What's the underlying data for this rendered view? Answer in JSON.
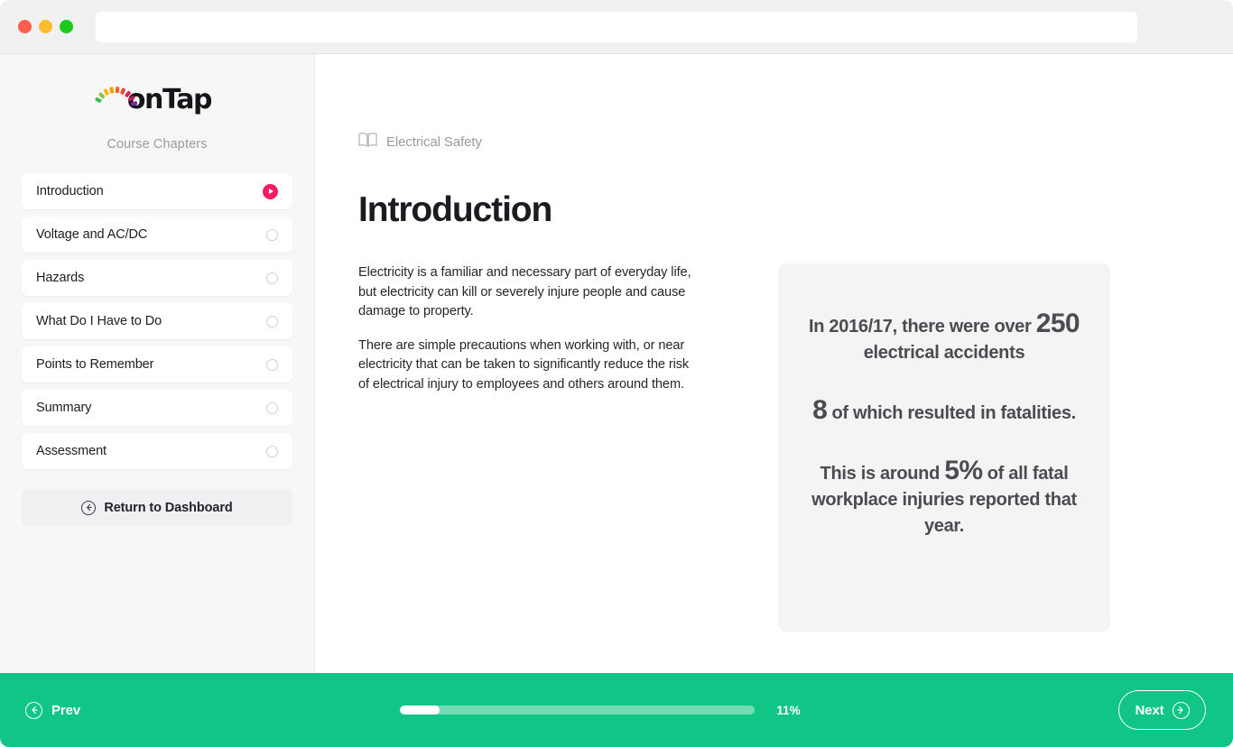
{
  "browser": {
    "url_value": "",
    "url_placeholder": "",
    "traffic_lights": [
      "close-red",
      "minimize-yellow",
      "maximize-green"
    ]
  },
  "sidebar": {
    "logo_text": "onTap",
    "logo_burst_colors": [
      "#3cba54",
      "#8bc34a",
      "#f7b500",
      "#f79f00",
      "#f26522",
      "#e8453c",
      "#e01e5a",
      "#c2185b",
      "#8e24aa"
    ],
    "section_label": "Course Chapters",
    "chapters": [
      {
        "label": "Introduction",
        "status": "current",
        "status_icon": "play-circle-icon"
      },
      {
        "label": "Voltage and AC/DC",
        "status": "incomplete",
        "status_icon": "circle-outline-icon"
      },
      {
        "label": "Hazards",
        "status": "incomplete",
        "status_icon": "circle-outline-icon"
      },
      {
        "label": "What Do I Have to Do",
        "status": "incomplete",
        "status_icon": "circle-outline-icon"
      },
      {
        "label": "Points to Remember",
        "status": "incomplete",
        "status_icon": "circle-outline-icon"
      },
      {
        "label": "Summary",
        "status": "incomplete",
        "status_icon": "circle-outline-icon"
      },
      {
        "label": "Assessment",
        "status": "incomplete",
        "status_icon": "circle-outline-icon"
      }
    ],
    "return_button": {
      "label": "Return to Dashboard",
      "icon": "arrow-left-circle-icon"
    }
  },
  "content": {
    "breadcrumb": {
      "icon": "book-open-icon",
      "text": "Electrical Safety"
    },
    "title": "Introduction",
    "paragraphs": [
      "Electricity is a familiar and necessary part of everyday life, but electricity can kill or severely injure people and cause damage to property.",
      "There are simple precautions when working with, or near electricity that can be taken to significantly reduce the risk of electrical injury to employees and others around them."
    ],
    "stat_card": {
      "stat_1": {
        "lead": "In 2016/17, there were over ",
        "number": "250",
        "trail": " electrical accidents"
      },
      "stat_2": {
        "number": "8",
        "trail": " of which resulted in fatalities."
      },
      "stat_3": {
        "lead": "This is around ",
        "number": "5%",
        "trail": " of all fatal workplace injuries reported that year."
      }
    }
  },
  "footer": {
    "prev_label": "Prev",
    "prev_icon": "arrow-left-circle-icon",
    "next_label": "Next",
    "next_icon": "arrow-right-circle-icon",
    "progress_percent_label": "11%",
    "progress_percent_value": 11
  },
  "colors": {
    "accent_green": "#10c586",
    "accent_pink": "#f31b63",
    "sidebar_bg": "#f7f7f8",
    "card_bg": "#f4f4f5",
    "progress_track": "#74dcb5"
  }
}
